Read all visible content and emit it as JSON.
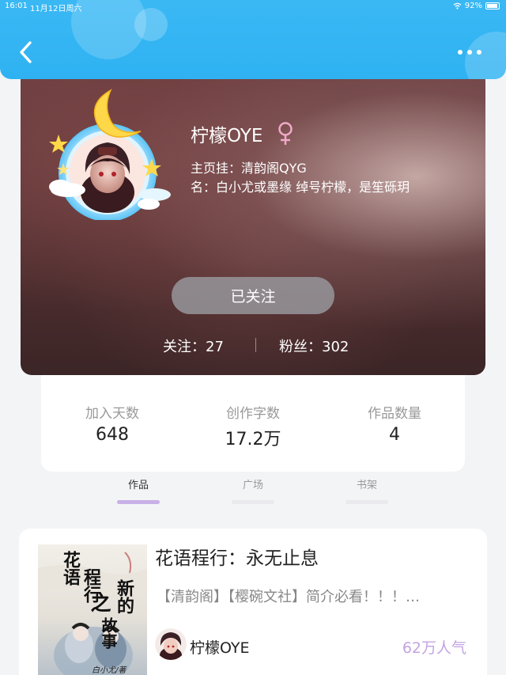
{
  "status_bar": {
    "time": "16:01",
    "date": "11月12日周六",
    "battery": "92%"
  },
  "header": {
    "back_icon": "chevron-left-icon",
    "more_icon": "more-dots-icon"
  },
  "profile": {
    "name": "柠檬OYE",
    "gender_icon": "female-icon",
    "bio_line1": "主页挂：清韵阁QYG",
    "bio_line2": "名：白小尤或墨缘 绰号柠檬，是笙砾玥",
    "follow_button": "已关注",
    "following_label": "关注：27",
    "fans_label": "粉丝：302"
  },
  "stats": [
    {
      "label": "加入天数",
      "value": "648"
    },
    {
      "label": "创作字数",
      "value": "17.2万"
    },
    {
      "label": "作品数量",
      "value": "4"
    }
  ],
  "tabs": [
    {
      "label": "作品",
      "active": true
    },
    {
      "label": "广场",
      "active": false
    },
    {
      "label": "书架",
      "active": false
    }
  ],
  "work": {
    "title": "花语程行：永无止息",
    "description": "【清韵阁】【樱碗文社】简介必看！！！…",
    "author": "柠檬OYE",
    "popularity": "62万人气",
    "cover_lines": [
      "花语",
      "程行",
      "之",
      "新的",
      "故事"
    ],
    "cover_author": "白小尤/著"
  },
  "colors": {
    "header": "#33b5f3",
    "accent": "#c8b1e6",
    "popularity": "#c3a4e0"
  }
}
